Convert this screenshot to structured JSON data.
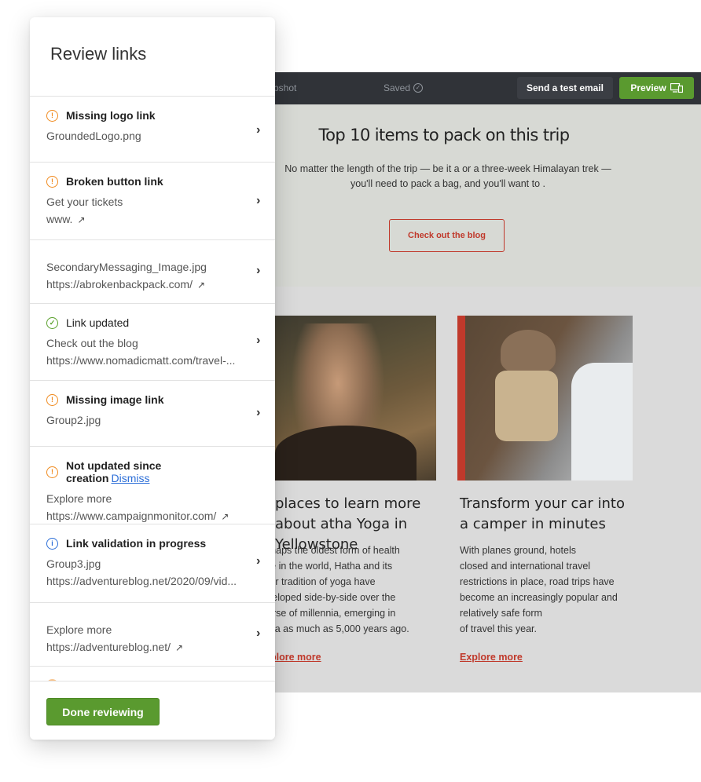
{
  "editor": {
    "toolbar": {
      "snapshot_label": "pshot",
      "saved_label": "Saved",
      "send_test_label": "Send a test email",
      "preview_label": "Preview"
    },
    "hero": {
      "title": "Top 10 items to pack on this trip",
      "body_line1": "No matter the length of the trip — be it a or a three-week Himalayan trek —",
      "body_line2": "you'll need to pack a bag, and you'll want to .",
      "button_label": "Check out the blog"
    },
    "columns": [
      {
        "title": "places to learn more about atha Yoga in Yellowstone",
        "body": [
          "rhaps the oldest form of health",
          "re in the world, Hatha and its",
          "ter tradition of yoga have",
          "veloped side-by-side over the",
          "urse of millennia, emerging in",
          "dia as much as 5,000 years ago."
        ],
        "link": "plore more"
      },
      {
        "title": "Transform your car into a camper in minutes",
        "body": [
          "With planes ground, hotels",
          "closed and international travel",
          "restrictions in place, road trips have",
          "become an increasingly popular and",
          "relatively safe form",
          "of travel this year."
        ],
        "link": "Explore more"
      }
    ]
  },
  "panel": {
    "title": "Review links",
    "items": [
      {
        "status": "warning",
        "heading": "Missing logo link",
        "line1": "GroundedLogo.png",
        "line2": ""
      },
      {
        "status": "warning",
        "heading": "Broken button link",
        "line1": "Get your tickets",
        "line2": "www."
      },
      {
        "status": "none",
        "heading": "",
        "line1": "SecondaryMessaging_Image.jpg",
        "line2": "https://abrokenbackpack.com/"
      },
      {
        "status": "ok",
        "heading": "Link updated",
        "line1": "Check out the blog",
        "line2": "https://www.nomadicmatt.com/travel-..."
      },
      {
        "status": "warning",
        "heading": "Missing image link",
        "line1": "Group2.jpg",
        "line2": ""
      },
      {
        "status": "warning",
        "heading": "Not updated since creation",
        "dismiss": "Dismiss",
        "line1": "Explore more",
        "line2": "https://www.campaignmonitor.com/"
      },
      {
        "status": "info",
        "heading": "Link validation in progress",
        "line1": "Group3.jpg",
        "line2": "https://adventureblog.net/2020/09/vid..."
      },
      {
        "status": "none",
        "heading": "",
        "line1": "Explore more",
        "line2": "https://adventureblog.net/"
      }
    ],
    "done_label": "Done reviewing"
  },
  "icons": {
    "warning": "exclamation-circle-icon",
    "ok": "check-circle-icon",
    "info": "info-circle-icon",
    "external": "external-link-icon",
    "chevron": "chevron-right-icon"
  },
  "colors": {
    "accent_green": "#5a9a2f",
    "warning_orange": "#f08a1e",
    "info_blue": "#2d6fd8",
    "link_red": "#c0392b",
    "toolbar_dark": "#303338"
  }
}
